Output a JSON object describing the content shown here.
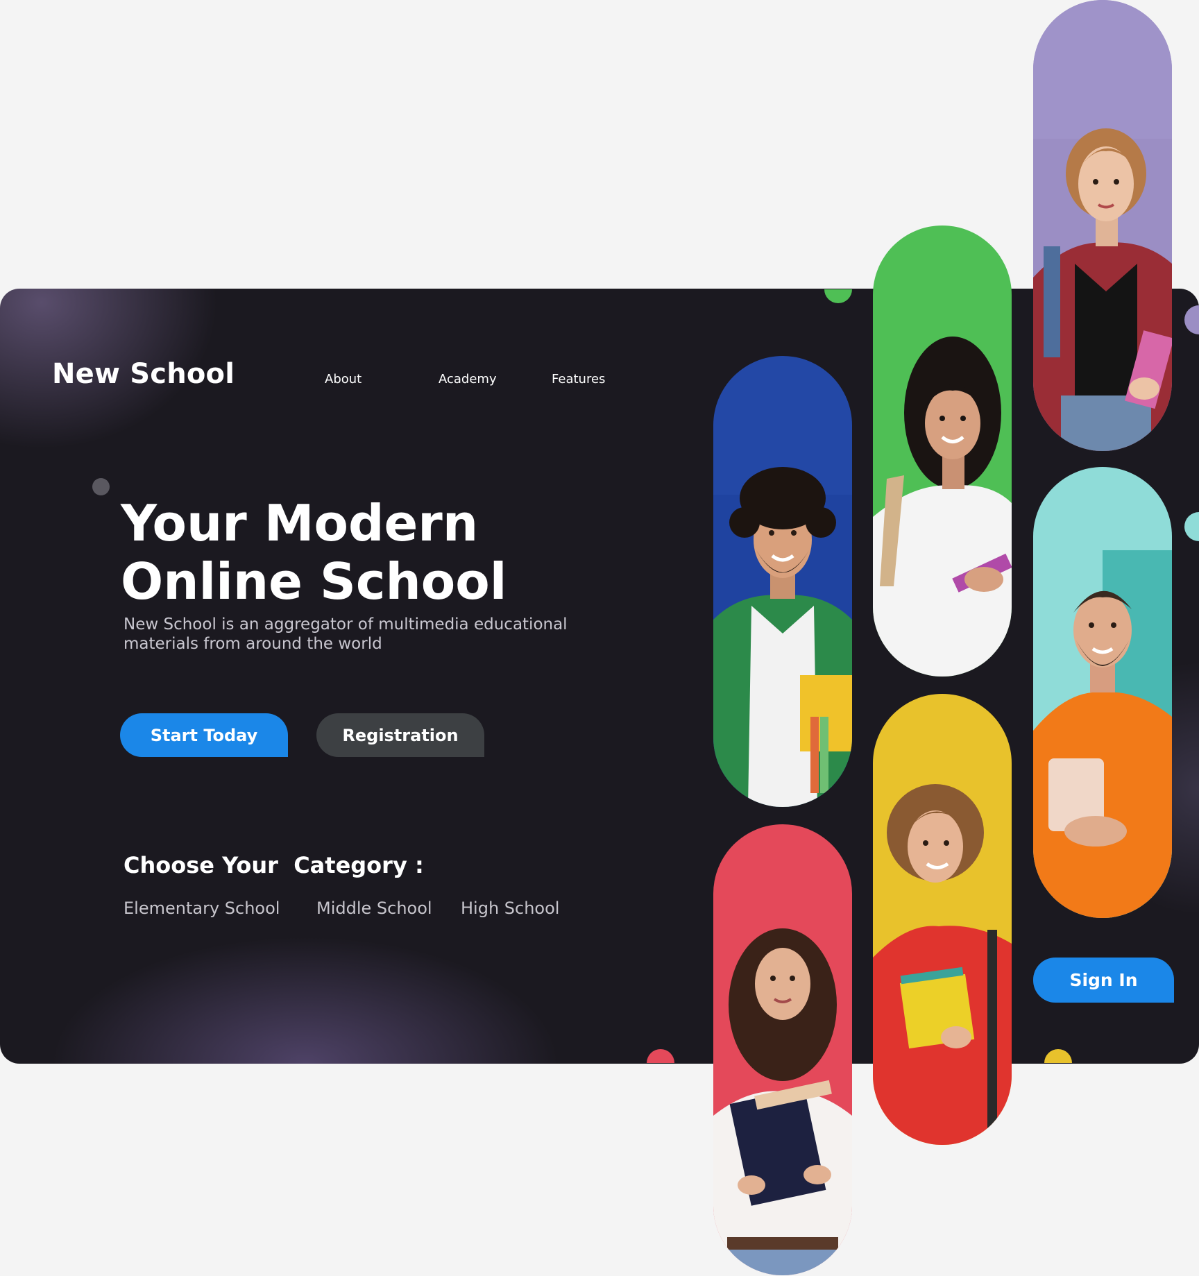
{
  "brand": {
    "name": "New School"
  },
  "nav": [
    {
      "label": "About"
    },
    {
      "label": "Academy"
    },
    {
      "label": "Features"
    }
  ],
  "hero": {
    "headline_line1": "Your Modern",
    "headline_line2": "Online School",
    "subtext": "New School is an aggregator of multimedia educational materials from around the world",
    "primary_button": "Start Today",
    "secondary_button": "Registration"
  },
  "categories": {
    "title": "Choose Your  Category :",
    "items": [
      "Elementary School",
      "Middle School",
      "High School"
    ]
  },
  "sidebar": {
    "signin_label": "Sign In"
  },
  "colors": {
    "accent": "#1b87e8",
    "card_bg": "#1b1920",
    "page_bg": "#f4f4f4",
    "pill_blue": "#2348a6",
    "pill_green": "#4fbf55",
    "pill_purple": "#9b8ec4",
    "pill_red": "#e4495a",
    "pill_yellow": "#e8c22c",
    "pill_cyan": "#8fdcd8"
  }
}
